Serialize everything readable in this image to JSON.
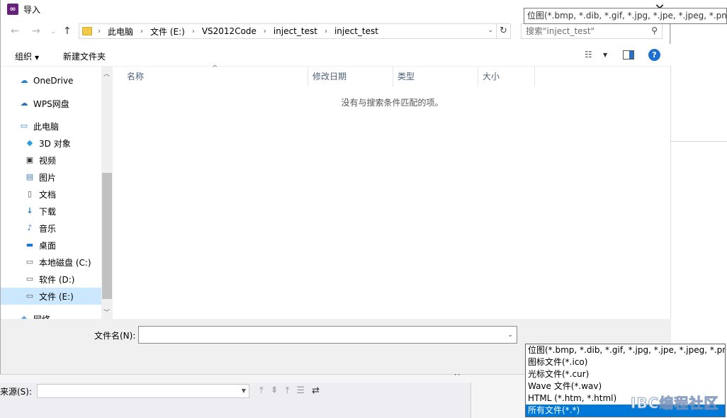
{
  "window": {
    "title": "导入"
  },
  "address": {
    "crumbs": [
      "此电脑",
      "文件 (E:)",
      "VS2012Code",
      "inject_test",
      "inject_test"
    ]
  },
  "search": {
    "placeholder": "搜索\"inject_test\""
  },
  "toolbar": {
    "organize": "组织",
    "new_folder": "新建文件夹"
  },
  "navpane": {
    "items": [
      {
        "label": "OneDrive",
        "icon": "cloud-icon"
      },
      {
        "label": "WPS网盘",
        "icon": "cloud-outline-icon"
      },
      {
        "label": "此电脑",
        "icon": "computer-icon"
      },
      {
        "label": "3D 对象",
        "icon": "cube-icon"
      },
      {
        "label": "视频",
        "icon": "video-icon"
      },
      {
        "label": "图片",
        "icon": "picture-icon"
      },
      {
        "label": "文档",
        "icon": "document-icon"
      },
      {
        "label": "下载",
        "icon": "download-icon"
      },
      {
        "label": "音乐",
        "icon": "music-icon"
      },
      {
        "label": "桌面",
        "icon": "desktop-icon"
      },
      {
        "label": "本地磁盘 (C:)",
        "icon": "drive-icon"
      },
      {
        "label": "软件 (D:)",
        "icon": "drive-icon"
      },
      {
        "label": "文件 (E:)",
        "icon": "drive-icon",
        "selected": true
      },
      {
        "label": "网络",
        "icon": "network-icon"
      }
    ]
  },
  "filelist": {
    "columns": [
      "名称",
      "修改日期",
      "类型",
      "大小"
    ],
    "empty_message": "没有与搜索条件匹配的项。"
  },
  "bottom": {
    "filename_label": "文件名(N):",
    "filename_value": "",
    "filetype_selected": "位图(*.bmp, *.dib, *.gif, *.jpg, *.jpe, *.jpeg, *.png)",
    "filetype_options": [
      "位图(*.bmp, *.dib, *.gif, *.jpg, *.jpe, *.jpeg, *.png)",
      "图标文件(*.ico)",
      "光标文件(*.cur)",
      "Wave 文件(*.wav)",
      "HTML (*.htm, *.html)",
      "所有文件(*.*)"
    ],
    "filetype_highlighted_index": 5
  },
  "background": {
    "combo_label": "来源(S):",
    "close_glyph": "×"
  },
  "watermark": "IBC编程社区",
  "colors": {
    "accent": "#0078d7",
    "selection": "#cce8ff",
    "vs_purple": "#68217a"
  }
}
